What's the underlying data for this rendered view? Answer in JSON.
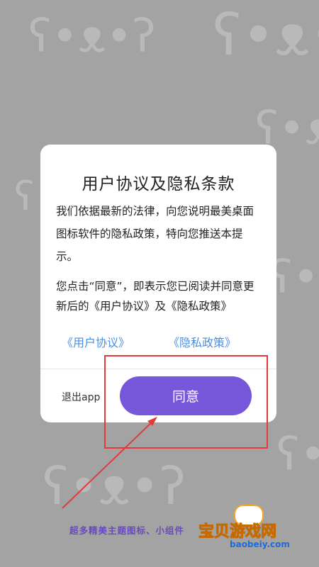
{
  "dialog": {
    "title": "用户协议及隐私条款",
    "paragraph1": "我们依据最新的法律，向您说明最美桌面图标软件的隐私政策，特向您推送本提示。",
    "paragraph2": "您点击“同意”，即表示您已阅读并同意更新后的《用户协议》及《隐私政策》",
    "link_user_agreement": "《用户协议》",
    "link_privacy_policy": "《隐私政策》",
    "exit_label": "退出app",
    "agree_label": "同意"
  },
  "footer": {
    "promo_text": "超多精美主题图标、小组件"
  },
  "watermark": {
    "name": "宝贝游戏网",
    "url": "baobeiy.com"
  },
  "colors": {
    "accent": "#7656d9",
    "link": "#4a8fe0",
    "annotation": "#e23b3b",
    "background": "#a3a3a3"
  }
}
